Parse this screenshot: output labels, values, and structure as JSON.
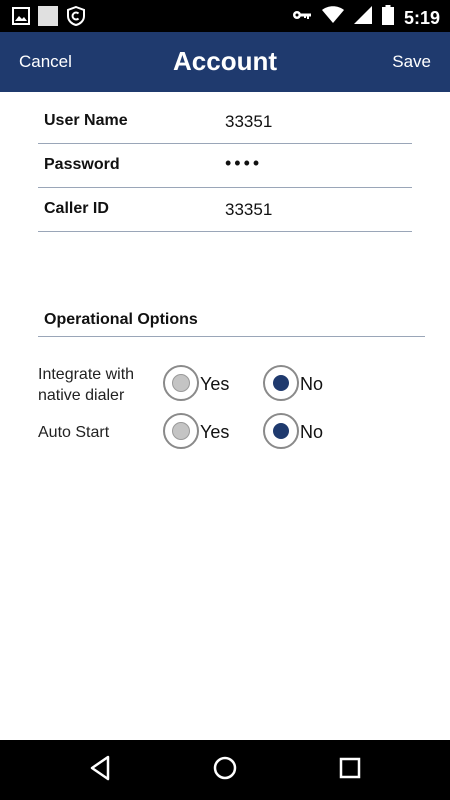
{
  "status_bar": {
    "time": "5:19",
    "icons": [
      "image-icon",
      "square-icon",
      "shield-icon",
      "key-icon",
      "wifi-icon",
      "signal-icon",
      "battery-icon"
    ]
  },
  "header": {
    "cancel_label": "Cancel",
    "title": "Account",
    "save_label": "Save",
    "background": "#1f3a6e"
  },
  "fields": [
    {
      "label": "User Name",
      "value": "33351"
    },
    {
      "label": "Password",
      "value": "••••"
    },
    {
      "label": "Caller ID",
      "value": "33351"
    }
  ],
  "operational_options": {
    "title": "Operational Options",
    "options": [
      {
        "label": "Integrate with native dialer",
        "yes_label": "Yes",
        "no_label": "No",
        "selected": "No"
      },
      {
        "label": "Auto Start",
        "yes_label": "Yes",
        "no_label": "No",
        "selected": "No"
      }
    ]
  },
  "nav_bar": {
    "icons": [
      "back-icon",
      "home-icon",
      "recents-icon"
    ]
  },
  "colors": {
    "accent": "#1f3a6e",
    "divider": "#9aa6b8"
  }
}
